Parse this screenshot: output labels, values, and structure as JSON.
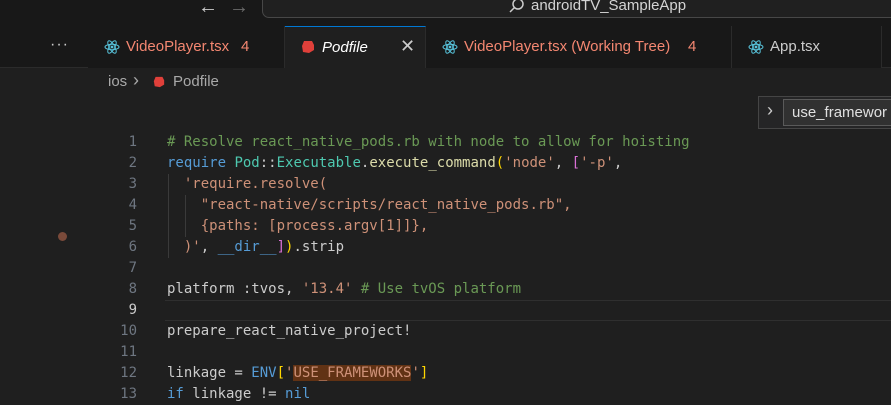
{
  "window": {
    "title": "androidTV_SampleApp",
    "nav_back": "←",
    "nav_forward": "→"
  },
  "tabs": [
    {
      "label": "VideoPlayer.tsx",
      "badge": "4",
      "icon": "react-icon",
      "state": "error"
    },
    {
      "label": "Podfile",
      "icon": "ruby-icon",
      "state": "active-preview",
      "close": "✕"
    },
    {
      "label": "VideoPlayer.tsx (Working Tree)",
      "badge": "4",
      "icon": "react-icon",
      "state": "error"
    },
    {
      "label": "App.tsx",
      "icon": "react-icon",
      "state": "normal"
    }
  ],
  "more_actions": "···",
  "breadcrumb": {
    "folder": "ios",
    "separator": "›",
    "file": "Podfile"
  },
  "sticky_find": {
    "chevron": "›",
    "text": "use_framewor"
  },
  "editor": {
    "current_line": 9,
    "line_numbers": [
      "1",
      "2",
      "3",
      "4",
      "5",
      "6",
      "7",
      "8",
      "9",
      "10",
      "11",
      "12",
      "13"
    ],
    "lines": [
      "# Resolve react_native_pods.rb with node to allow for hoisting",
      "require Pod::Executable.execute_command('node', ['-p',",
      "  'require.resolve(",
      "    \"react-native/scripts/react_native_pods.rb\",",
      "    {paths: [process.argv[1]]},",
      "  )', __dir__]).strip",
      "",
      "platform :tvos, '13.4' # Use tvOS platform",
      "",
      "prepare_react_native_project!",
      "",
      "linkage = ENV['USE_FRAMEWORKS']",
      "if linkage != nil"
    ]
  },
  "colors": {
    "background": "#1f1f1f",
    "comment": "#6a9955",
    "keyword": "#569cd6",
    "string": "#ce9178",
    "type": "#4ec9b0",
    "error_tab": "#f48771",
    "find_highlight": "#613214"
  }
}
